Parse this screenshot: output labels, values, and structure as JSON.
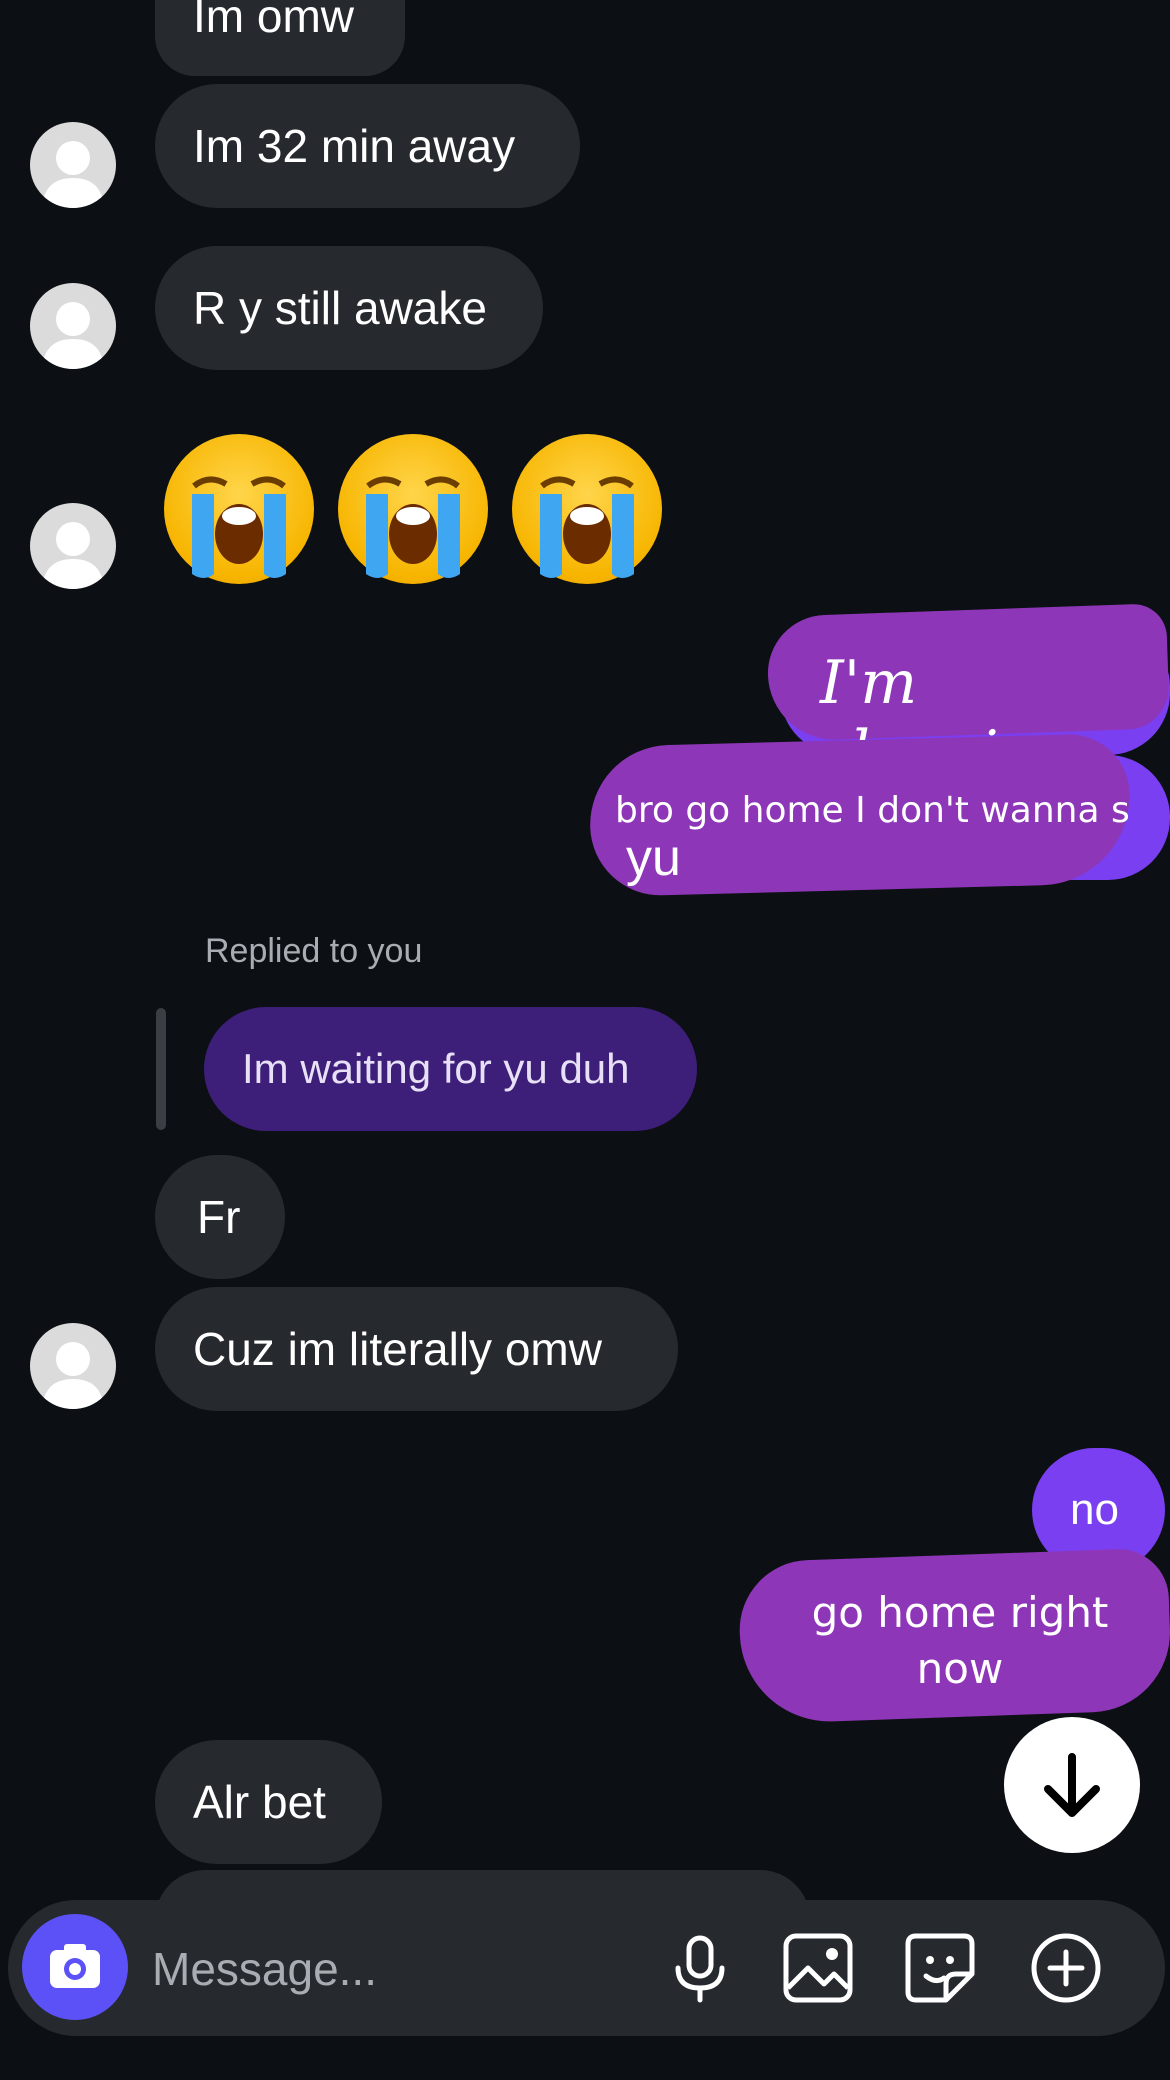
{
  "messages": {
    "m1": "Im omw",
    "m2": "Im 32 min away",
    "m3": "R y still awake",
    "emoji_reaction": "😭😭😭",
    "mine1": "I'm sleeping",
    "mine2": "bro go home I don't wanna s",
    "mine2_cont": "yu",
    "replied_label": "Replied to you",
    "quoted": "Im waiting for yu duh",
    "m4": "Fr",
    "m5": "Cuz im literally omw",
    "mine3": "no",
    "mine4_line1": "go home right",
    "mine4_line2": "now",
    "m6": "Alr bet"
  },
  "composer": {
    "placeholder": "Message..."
  },
  "icons": {
    "camera": "camera-icon",
    "mic": "microphone-icon",
    "gallery": "gallery-icon",
    "sticker": "sticker-icon",
    "plus": "plus-circle-icon",
    "scroll_down": "arrow-down-icon"
  },
  "colors": {
    "background": "#0c1014",
    "incoming_bubble": "#262a2f",
    "outgoing_bubble": "#7a3ff0",
    "quoted_bubble": "#3d1f7a",
    "scribble": "#8e36b8",
    "camera_button": "#5b51f6"
  }
}
